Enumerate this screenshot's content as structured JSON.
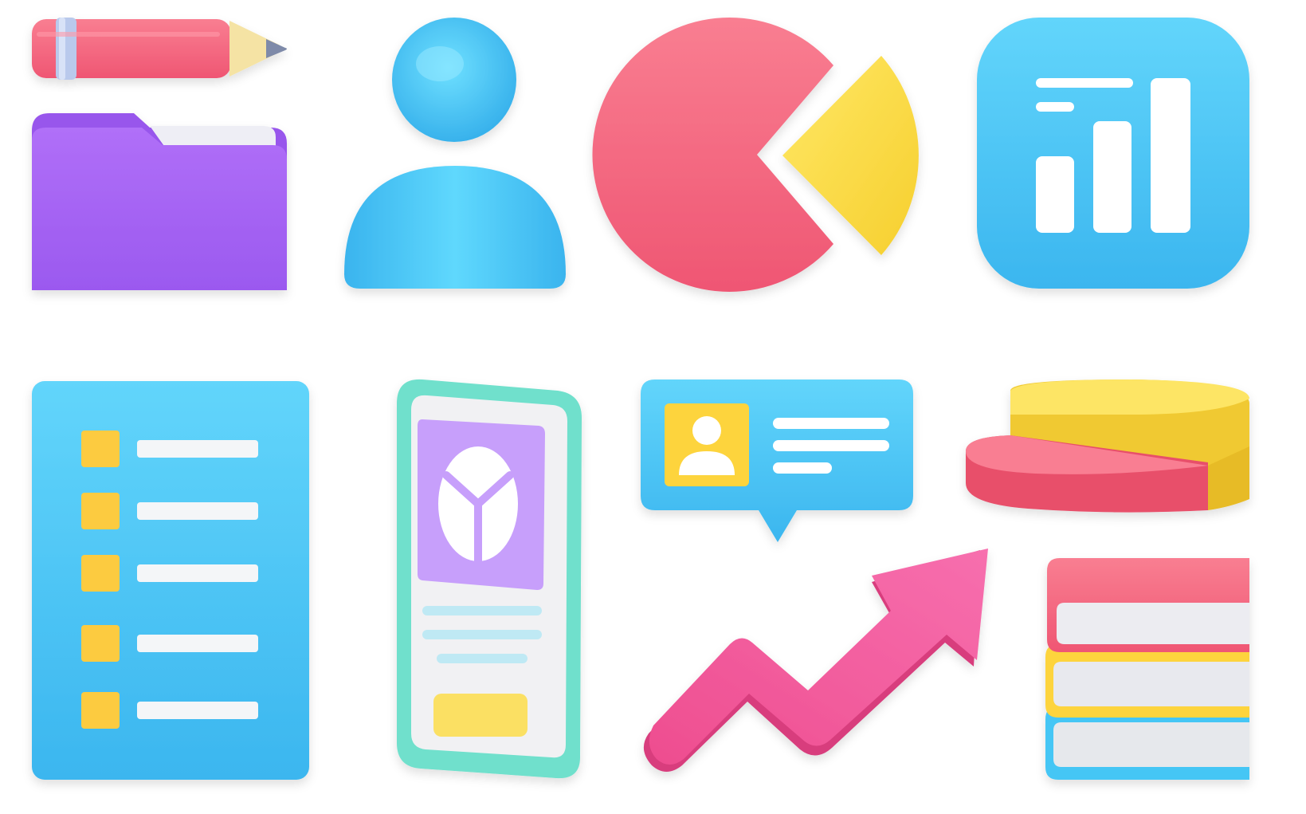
{
  "icons": [
    {
      "name": "pencil-icon"
    },
    {
      "name": "folder-icon"
    },
    {
      "name": "user-avatar-icon"
    },
    {
      "name": "pie-chart-icon"
    },
    {
      "name": "bar-chart-app-icon"
    },
    {
      "name": "checklist-document-icon"
    },
    {
      "name": "smartphone-report-icon"
    },
    {
      "name": "profile-message-bubble-icon"
    },
    {
      "name": "3d-pie-chart-icon"
    },
    {
      "name": "growth-arrow-icon"
    },
    {
      "name": "book-stack-icon"
    }
  ],
  "colors": {
    "background": "#ffffff",
    "pink": "#f25f7a",
    "blue": "#45c6f5",
    "yellow": "#fddf4a",
    "purple": "#a865f4",
    "lavender": "#c39cf9",
    "mint": "#6fe0cc",
    "magenta": "#f2559c",
    "paper": "#f3f3f5"
  }
}
